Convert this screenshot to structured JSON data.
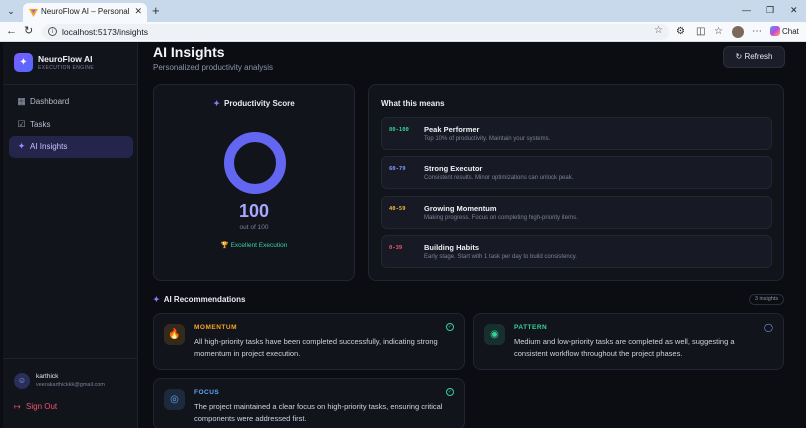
{
  "browser": {
    "tab_title": "NeuroFlow AI – Personal Execution",
    "url": "localhost:5173/insights",
    "chat_label": "Chat"
  },
  "sidebar": {
    "brand_name": "NeuroFlow AI",
    "brand_sub": "EXECUTION ENGINE",
    "items": [
      {
        "label": "Dashboard",
        "icon": "grid-icon",
        "active": false
      },
      {
        "label": "Tasks",
        "icon": "checkbox-icon",
        "active": false
      },
      {
        "label": "AI Insights",
        "icon": "sparkles-icon",
        "active": true
      }
    ],
    "user": {
      "name": "karthick",
      "email": "veerakarthickkk@gmail.com"
    },
    "signout_label": "Sign Out"
  },
  "header": {
    "title": "AI Insights",
    "subtitle": "Personalized productivity analysis",
    "refresh_label": "Refresh"
  },
  "score": {
    "title": "Productivity Score",
    "value": "100",
    "out_of": "out of 100",
    "badge": "Excellent Execution",
    "fraction": 1.0,
    "ring_color": "#6366f1"
  },
  "meaning": {
    "title": "What this means",
    "tiers": [
      {
        "range": "80-100",
        "name": "Peak Performer",
        "desc": "Top 10% of productivity. Maintain your systems.",
        "color": "#34d399"
      },
      {
        "range": "60-79",
        "name": "Strong Executor",
        "desc": "Consistent results. Minor optimizations can unlock peak.",
        "color": "#8b9cff"
      },
      {
        "range": "40-59",
        "name": "Growing Momentum",
        "desc": "Making progress. Focus on completing high-priority items.",
        "color": "#f5b942"
      },
      {
        "range": "0-39",
        "name": "Building Habits",
        "desc": "Early stage. Start with 1 task per day to build consistency.",
        "color": "#f0556d"
      }
    ]
  },
  "recommendations": {
    "title": "AI Recommendations",
    "count_label": "3 insights",
    "items": [
      {
        "label": "MOMENTUM",
        "text": "All high-priority tasks have been completed successfully, indicating strong momentum in project execution.",
        "color": "#f5a524",
        "icon": "flame-icon"
      },
      {
        "label": "PATTERN",
        "text": "Medium and low-priority tasks are completed as well, suggesting a consistent workflow throughout the project phases.",
        "color": "#34d399",
        "icon": "award-icon"
      },
      {
        "label": "FOCUS",
        "text": "The project maintained a clear focus on high-priority tasks, ensuring critical components were addressed first.",
        "color": "#60a5fa",
        "icon": "target-icon"
      }
    ]
  }
}
